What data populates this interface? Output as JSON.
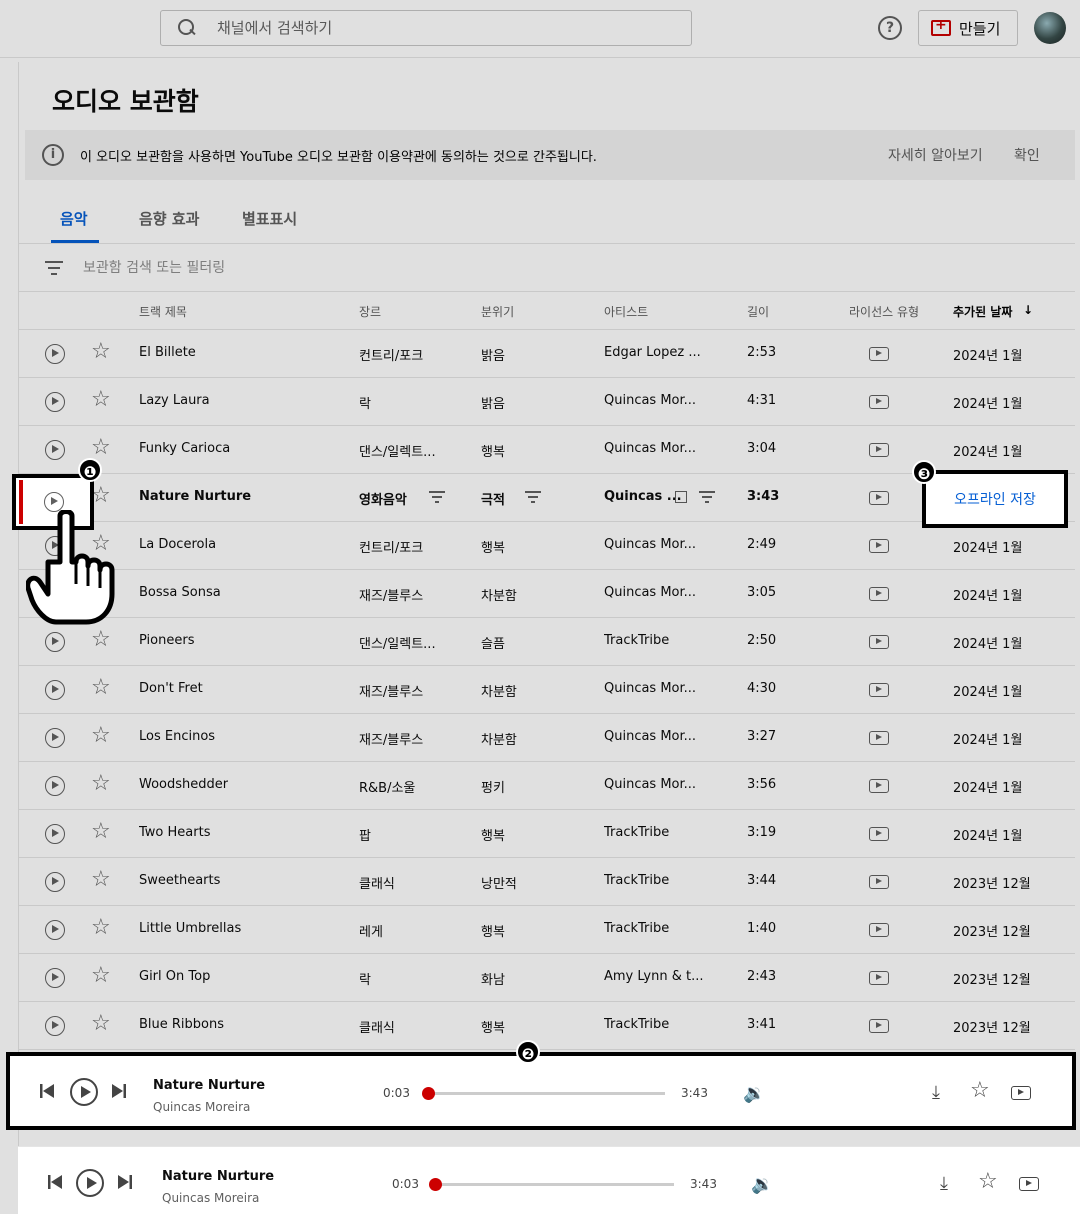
{
  "header": {
    "search_placeholder": "채널에서 검색하기",
    "help_label": "?",
    "create_label": "만들기"
  },
  "page": {
    "title": "오디오 보관함",
    "notice": {
      "text": "이 오디오 보관함을 사용하면 YouTube 오디오 보관함 이용약관에 동의하는 것으로 간주됩니다.",
      "learn_more": "자세히 알아보기",
      "confirm": "확인"
    },
    "tabs": [
      "음악",
      "음향 효과",
      "별표표시"
    ],
    "filter_placeholder": "보관함 검색 또는 필터링",
    "columns": {
      "title": "트랙 제목",
      "genre": "장르",
      "mood": "분위기",
      "artist": "아티스트",
      "length": "길이",
      "license": "라이선스 유형",
      "date": "추가된 날짜",
      "sort_arrow": "↓"
    }
  },
  "tracks": [
    {
      "title": "El Billete",
      "genre": "컨트리/포크",
      "mood": "밝음",
      "artist": "Edgar Lopez ...",
      "length": "2:53",
      "date": "2024년 1월"
    },
    {
      "title": "Lazy Laura",
      "genre": "락",
      "mood": "밝음",
      "artist": "Quincas Mor...",
      "length": "4:31",
      "date": "2024년 1월"
    },
    {
      "title": "Funky Carioca",
      "genre": "댄스/일렉트...",
      "mood": "행복",
      "artist": "Quincas Mor...",
      "length": "3:04",
      "date": "2024년 1월"
    },
    {
      "title": "Nature Nurture",
      "genre": "영화음악",
      "mood": "극적",
      "artist": "Quincas ...",
      "length": "3:43",
      "date": ""
    },
    {
      "title": "La Docerola",
      "genre": "컨트리/포크",
      "mood": "행복",
      "artist": "Quincas Mor...",
      "length": "2:49",
      "date": "2024년 1월"
    },
    {
      "title": "Bossa Sonsa",
      "genre": "재즈/블루스",
      "mood": "차분함",
      "artist": "Quincas Mor...",
      "length": "3:05",
      "date": "2024년 1월"
    },
    {
      "title": "Pioneers",
      "genre": "댄스/일렉트...",
      "mood": "슬픔",
      "artist": "TrackTribe",
      "length": "2:50",
      "date": "2024년 1월"
    },
    {
      "title": "Don't Fret",
      "genre": "재즈/블루스",
      "mood": "차분함",
      "artist": "Quincas Mor...",
      "length": "4:30",
      "date": "2024년 1월"
    },
    {
      "title": "Los Encinos",
      "genre": "재즈/블루스",
      "mood": "차분함",
      "artist": "Quincas Mor...",
      "length": "3:27",
      "date": "2024년 1월"
    },
    {
      "title": "Woodshedder",
      "genre": "R&B/소울",
      "mood": "펑키",
      "artist": "Quincas Mor...",
      "length": "3:56",
      "date": "2024년 1월"
    },
    {
      "title": "Two Hearts",
      "genre": "팝",
      "mood": "행복",
      "artist": "TrackTribe",
      "length": "3:19",
      "date": "2024년 1월"
    },
    {
      "title": "Sweethearts",
      "genre": "클래식",
      "mood": "낭만적",
      "artist": "TrackTribe",
      "length": "3:44",
      "date": "2023년 12월"
    },
    {
      "title": "Little Umbrellas",
      "genre": "레게",
      "mood": "행복",
      "artist": "TrackTribe",
      "length": "1:40",
      "date": "2023년 12월"
    },
    {
      "title": "Girl On Top",
      "genre": "락",
      "mood": "화남",
      "artist": "Amy Lynn & t...",
      "length": "2:43",
      "date": "2023년 12월"
    },
    {
      "title": "Blue Ribbons",
      "genre": "클래식",
      "mood": "행복",
      "artist": "TrackTribe",
      "length": "3:41",
      "date": "2023년 12월"
    }
  ],
  "save_offline": "오프라인 저장",
  "player": {
    "track": "Nature Nurture",
    "artist": "Quincas Moreira",
    "current": "0:03",
    "duration": "3:43",
    "progress_fraction": 0.013
  },
  "badges": [
    "❶",
    "❷",
    "❸"
  ],
  "colors": {
    "accent": "#065fd4",
    "progress": "#cc0000"
  }
}
